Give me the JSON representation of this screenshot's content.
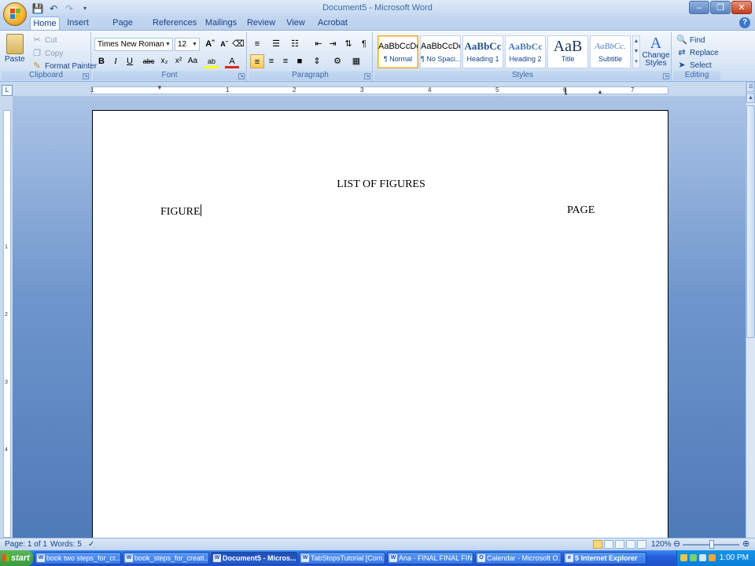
{
  "window": {
    "title": "Document5 - Microsoft Word"
  },
  "quick_access": {
    "icons": [
      "save-icon",
      "undo-icon",
      "redo-icon",
      "customize-icon"
    ]
  },
  "tabs": [
    "Home",
    "Insert",
    "Page Layout",
    "References",
    "Mailings",
    "Review",
    "View",
    "Acrobat"
  ],
  "clipboard": {
    "paste": "Paste",
    "cut": "Cut",
    "copy": "Copy",
    "format_painter": "Format Painter",
    "label": "Clipboard"
  },
  "font": {
    "name": "Times New Roman",
    "size": "12",
    "label": "Font"
  },
  "paragraph": {
    "label": "Paragraph"
  },
  "styles": {
    "label": "Styles",
    "items": [
      {
        "sample": "AaBbCcDc",
        "name": "¶ Normal"
      },
      {
        "sample": "AaBbCcDc",
        "name": "¶ No Spaci..."
      },
      {
        "sample": "AaBbCc",
        "name": "Heading 1"
      },
      {
        "sample": "AaBbCc",
        "name": "Heading 2"
      },
      {
        "sample": "AaB",
        "name": "Title"
      },
      {
        "sample": "AaBbCc.",
        "name": "Subtitle"
      }
    ],
    "change_styles": "Change Styles"
  },
  "editing": {
    "find": "Find",
    "replace": "Replace",
    "select": "Select",
    "label": "Editing"
  },
  "ruler": {
    "h_numbers": [
      "1",
      "1",
      "2",
      "3",
      "4",
      "5",
      "6",
      "7"
    ],
    "v_numbers": [
      "1",
      "2",
      "3",
      "4"
    ]
  },
  "document": {
    "heading": "LIST OF FIGURES",
    "left_column": "FIGURE",
    "right_column": "PAGE"
  },
  "status": {
    "page": "Page: 1 of 1",
    "words": "Words: 5",
    "zoom": "120%"
  },
  "taskbar": {
    "start": "start",
    "tasks": [
      "book two steps_for_cr...",
      "book_steps_for_creati...",
      "Document5 - Micros...",
      "TabStopsTutorial [Com...",
      "Ana - FINAL FINAL FIN...",
      "Calendar - Microsoft O...",
      "5 Internet Explorer"
    ],
    "clock": "1:00 PM"
  }
}
